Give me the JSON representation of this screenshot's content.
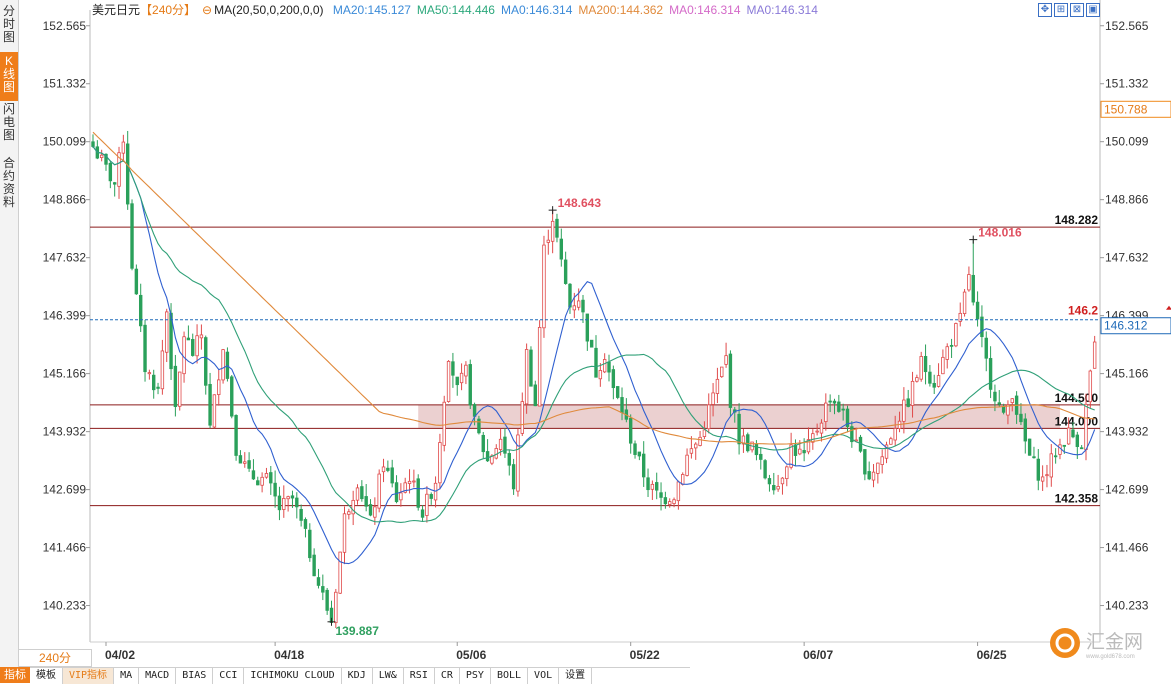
{
  "sidebar": [
    {
      "label": "分时图",
      "active": false
    },
    {
      "label": "K线图",
      "active": true
    },
    {
      "label": "闪电图",
      "active": false
    },
    {
      "label": "合约资料",
      "active": false
    }
  ],
  "header": {
    "symbol": "美元日元",
    "period": "【240分】",
    "ma_params": "MA(20,50,0,200,0,0)",
    "ma_values": [
      {
        "text": "MA20:145.127",
        "color": "#3a8ad8"
      },
      {
        "text": "MA50:144.446",
        "color": "#2ca87c"
      },
      {
        "text": "MA0:146.314",
        "color": "#3a8ad8"
      },
      {
        "text": "MA200:144.362",
        "color": "#e08a3c"
      },
      {
        "text": "MA0:146.314",
        "color": "#d46ac8"
      },
      {
        "text": "MA0:146.314",
        "color": "#8a7ad8"
      }
    ]
  },
  "window_buttons": [
    "✥",
    "⊞",
    "⊠",
    "▣"
  ],
  "period_selector": "240分",
  "first_tab": "指标",
  "bottom_tabs": [
    "模板",
    "VIP指标",
    "MA",
    "MACD",
    "BIAS",
    "CCI",
    "ICHIMOKU CLOUD",
    "KDJ",
    "LW&",
    "RSI",
    "CR",
    "PSY",
    "BOLL",
    "VOL",
    "设置"
  ],
  "logo": {
    "text": "汇金网",
    "sub": "www.gold678.com"
  },
  "chart_data": {
    "type": "candlestick",
    "ylim": [
      139.5,
      152.9
    ],
    "y_ticks": [
      "152.565",
      "151.332",
      "150.099",
      "148.866",
      "147.632",
      "146.399",
      "145.166",
      "143.932",
      "142.699",
      "141.466",
      "140.233"
    ],
    "x_ticks": [
      {
        "label": "04/02",
        "i": 3
      },
      {
        "label": "04/18",
        "i": 42
      },
      {
        "label": "05/06",
        "i": 84
      },
      {
        "label": "05/22",
        "i": 124
      },
      {
        "label": "06/07",
        "i": 164
      },
      {
        "label": "06/25",
        "i": 204
      }
    ],
    "n_bars": 232,
    "anchors": [
      [
        0,
        150.0
      ],
      [
        5,
        149.2
      ],
      [
        7,
        150.2
      ],
      [
        9,
        147.5
      ],
      [
        12,
        145.3
      ],
      [
        15,
        144.8
      ],
      [
        17,
        146.5
      ],
      [
        19,
        144.3
      ],
      [
        21,
        146.0
      ],
      [
        23,
        145.6
      ],
      [
        25,
        146.0
      ],
      [
        27,
        144.0
      ],
      [
        30,
        145.8
      ],
      [
        33,
        143.6
      ],
      [
        36,
        143.0
      ],
      [
        40,
        142.9
      ],
      [
        43,
        142.3
      ],
      [
        46,
        142.5
      ],
      [
        49,
        141.7
      ],
      [
        52,
        140.7
      ],
      [
        55,
        139.9
      ],
      [
        58,
        142.1
      ],
      [
        61,
        142.9
      ],
      [
        64,
        142.0
      ],
      [
        67,
        143.3
      ],
      [
        70,
        142.5
      ],
      [
        73,
        143.0
      ],
      [
        76,
        142.2
      ],
      [
        79,
        142.9
      ],
      [
        82,
        145.6
      ],
      [
        84,
        144.8
      ],
      [
        86,
        145.2
      ],
      [
        88,
        144.1
      ],
      [
        91,
        143.3
      ],
      [
        94,
        143.8
      ],
      [
        97,
        142.8
      ],
      [
        100,
        145.6
      ],
      [
        102,
        144.5
      ],
      [
        104,
        147.8
      ],
      [
        106,
        148.5
      ],
      [
        108,
        147.5
      ],
      [
        110,
        146.6
      ],
      [
        112,
        146.8
      ],
      [
        114,
        146.0
      ],
      [
        116,
        145.2
      ],
      [
        118,
        145.6
      ],
      [
        120,
        144.8
      ],
      [
        122,
        144.4
      ],
      [
        125,
        143.5
      ],
      [
        128,
        142.8
      ],
      [
        131,
        142.5
      ],
      [
        134,
        142.6
      ],
      [
        137,
        143.4
      ],
      [
        140,
        143.8
      ],
      [
        143,
        144.7
      ],
      [
        146,
        145.5
      ],
      [
        147,
        144.6
      ],
      [
        149,
        143.8
      ],
      [
        152,
        143.6
      ],
      [
        155,
        143.0
      ],
      [
        158,
        142.8
      ],
      [
        161,
        143.6
      ],
      [
        164,
        143.4
      ],
      [
        167,
        144.0
      ],
      [
        170,
        144.7
      ],
      [
        173,
        144.3
      ],
      [
        176,
        143.6
      ],
      [
        179,
        143.0
      ],
      [
        182,
        143.4
      ],
      [
        185,
        144.1
      ],
      [
        188,
        144.6
      ],
      [
        191,
        145.4
      ],
      [
        194,
        145.0
      ],
      [
        197,
        145.7
      ],
      [
        200,
        146.3
      ],
      [
        202,
        147.3
      ],
      [
        203,
        146.6
      ],
      [
        205,
        145.8
      ],
      [
        207,
        145.0
      ],
      [
        210,
        144.2
      ],
      [
        212,
        144.8
      ],
      [
        214,
        144.0
      ],
      [
        216,
        143.4
      ],
      [
        219,
        142.9
      ],
      [
        222,
        143.5
      ],
      [
        225,
        143.9
      ],
      [
        228,
        143.7
      ],
      [
        230,
        145.2
      ],
      [
        232,
        146.2
      ]
    ],
    "highlights": [
      {
        "i": 106,
        "value": 148.643
      },
      {
        "i": 203,
        "value": 148.016
      }
    ],
    "low_marker": {
      "i": 55,
      "value": 139.887
    },
    "h_lines": [
      {
        "value": 148.282,
        "label": "148.282"
      },
      {
        "value": 144.5,
        "label": "144.500"
      },
      {
        "value": 144.0,
        "label": "144.000"
      },
      {
        "value": 142.358,
        "label": "142.358"
      }
    ],
    "zone": {
      "from": 144.0,
      "to": 144.5
    },
    "current_price": {
      "value": 146.312,
      "label": "146.312",
      "left_label": "146.2"
    },
    "axis_tag": {
      "value": 150.788,
      "label": "150.788"
    },
    "colors": {
      "up": "#e04a4a",
      "down": "#2aa05a",
      "ma20": "#3060d0",
      "ma50": "#30a078",
      "ma200": "#e08a3c",
      "level": "#8b1a1a",
      "zone": "#e8c8c8",
      "current": "#1e6ab8"
    }
  }
}
